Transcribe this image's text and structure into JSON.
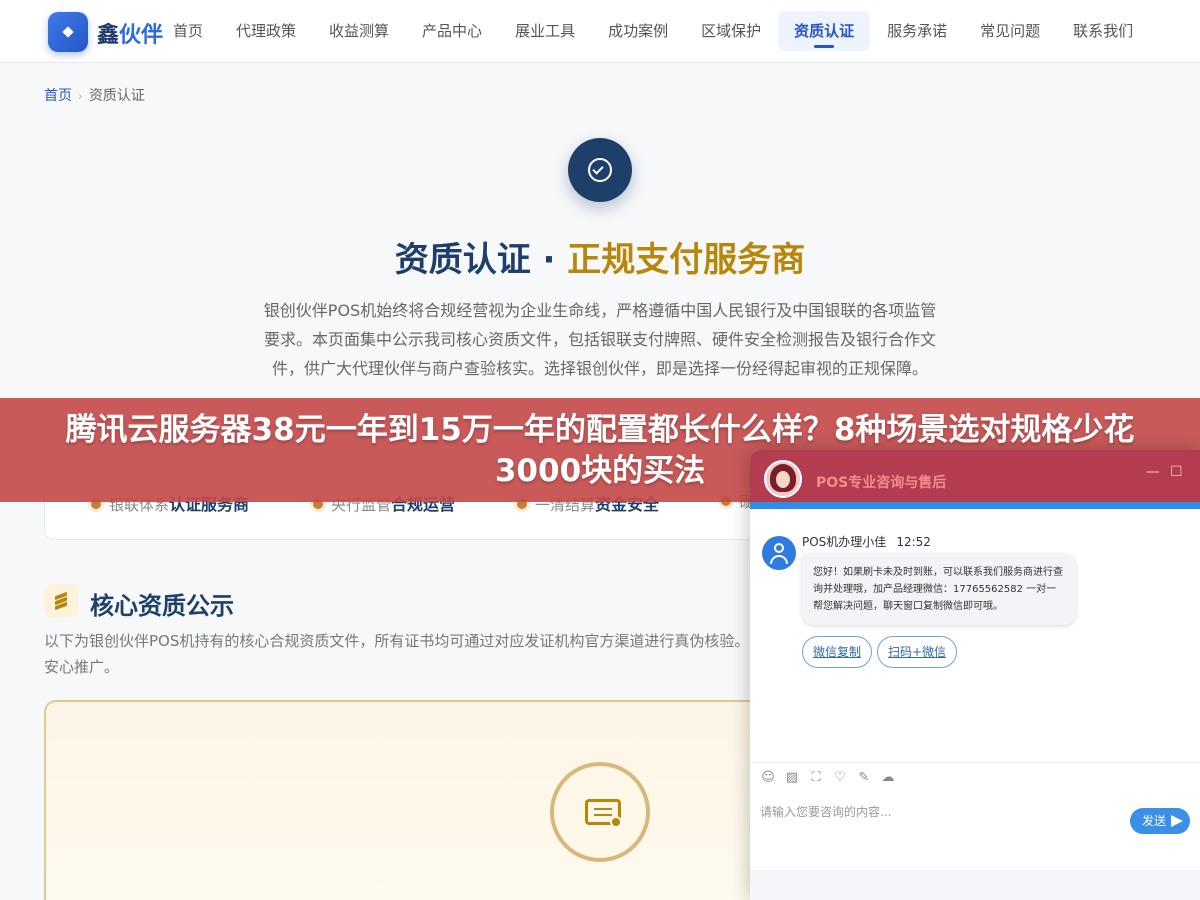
{
  "header": {
    "logo_part1": "鑫",
    "logo_part2": "伙伴",
    "nav": [
      {
        "label": "首页"
      },
      {
        "label": "代理政策"
      },
      {
        "label": "收益测算"
      },
      {
        "label": "产品中心"
      },
      {
        "label": "展业工具"
      },
      {
        "label": "成功案例"
      },
      {
        "label": "区域保护"
      },
      {
        "label": "资质认证",
        "active": true
      },
      {
        "label": "服务承诺"
      },
      {
        "label": "常见问题"
      },
      {
        "label": "联系我们"
      }
    ]
  },
  "breadcrumb": {
    "home": "首页",
    "separator": "›",
    "current": "资质认证"
  },
  "hero": {
    "icon": "check-circle-icon",
    "title_main": "资质认证 · ",
    "title_accent": "正规支付服务商",
    "description": "银创伙伴POS机始终将合规经营视为企业生命线，严格遵循中国人民银行及中国银联的各项监管要求。本页面集中公示我司核心资质文件，包括银联支付牌照、硬件安全检测报告及银行合作文件，供广大代理伙伴与商户查验核实。选择银创伙伴，即是选择一份经得起审视的正规保障。"
  },
  "badges": [
    {
      "prefix": "银联体系",
      "emphasis": "认证服务商"
    },
    {
      "prefix": "央行监管",
      "emphasis": "合规运营"
    },
    {
      "prefix": "一清结算",
      "emphasis": "资金安全"
    },
    {
      "prefix": "硬",
      "emphasis": ""
    }
  ],
  "section": {
    "icon": "layers-icon",
    "title": "核心资质公示",
    "description": "以下为银创伙伴POS机持有的核心合规资质文件，所有证书均可通过对应发证机构官方渠道进行真伪核验。",
    "description_line2": "安心推广。",
    "card_icon": "certificate-icon"
  },
  "banner": {
    "text": "腾讯云服务器38元一年到15万一年的配置都长什么样？8种场景选对规格少花3000块的买法"
  },
  "chat": {
    "title": "POS专业咨询与售后",
    "minimize": "—",
    "maximize": "☐",
    "agent_name": "POS机办理小佳",
    "time": "12:52",
    "message": "您好！如果刷卡未及时到账，可以联系我们服务商进行查询并处理哦，加产品经理微信：17765562582 一对一帮您解决问题，聊天窗口复制微信即可哦。",
    "quick_replies": [
      "微信复制",
      "扫码+微信"
    ],
    "tools": [
      "☺",
      "▨",
      "⛶",
      "♡",
      "✎",
      "☁"
    ],
    "input_placeholder": "请输入您要咨询的内容...",
    "send_label": "发送"
  },
  "colors": {
    "brand": "#2456c8",
    "navy": "#1f3f6b",
    "gold": "#b8860b",
    "banner": "#c44848",
    "chat_header": "#b43c50",
    "chat_accent": "#2f8de6"
  }
}
